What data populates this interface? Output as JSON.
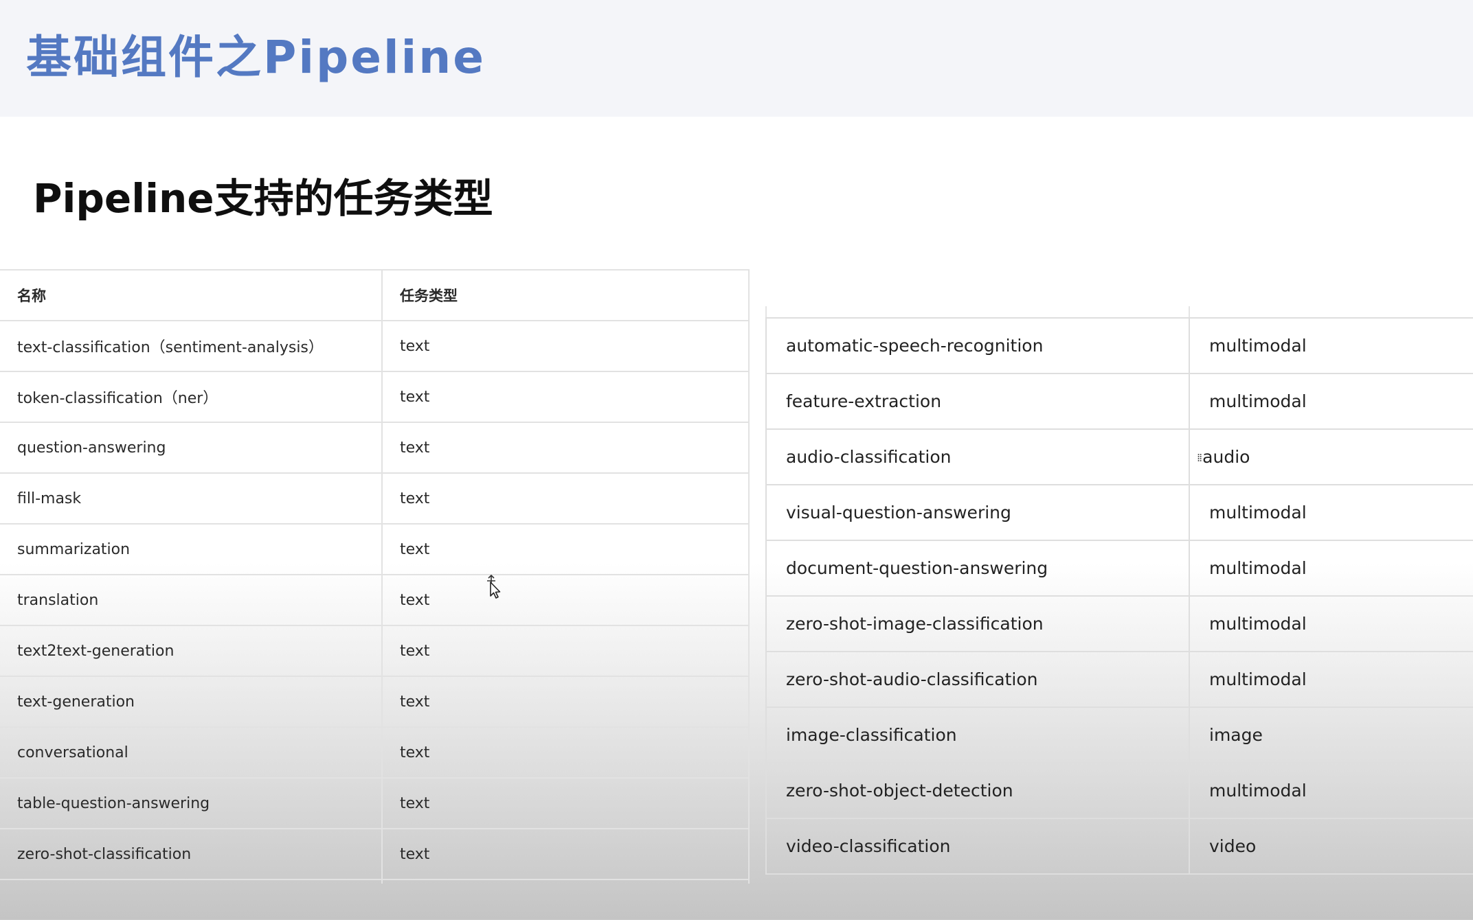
{
  "header": {
    "title": "基础组件之Pipeline"
  },
  "slide": {
    "title": "Pipeline支持的任务类型"
  },
  "left_table": {
    "headers": [
      "名称",
      "任务类型"
    ],
    "rows": [
      [
        "text-classification（sentiment-analysis）",
        "text"
      ],
      [
        "token-classification（ner）",
        "text"
      ],
      [
        "question-answering",
        "text"
      ],
      [
        "fill-mask",
        "text"
      ],
      [
        "summarization",
        "text"
      ],
      [
        "translation",
        "text"
      ],
      [
        "text2text-generation",
        "text"
      ],
      [
        "text-generation",
        "text"
      ],
      [
        "conversational",
        "text"
      ],
      [
        "table-question-answering",
        "text"
      ],
      [
        "zero-shot-classification",
        "text"
      ]
    ]
  },
  "right_table": {
    "rows": [
      [
        "automatic-speech-recognition",
        "multimodal"
      ],
      [
        "feature-extraction",
        "multimodal"
      ],
      [
        "audio-classification",
        "audio"
      ],
      [
        "visual-question-answering",
        "multimodal"
      ],
      [
        "document-question-answering",
        "multimodal"
      ],
      [
        "zero-shot-image-classification",
        "multimodal"
      ],
      [
        "zero-shot-audio-classification",
        "multimodal"
      ],
      [
        "image-classification",
        "image"
      ],
      [
        "zero-shot-object-detection",
        "multimodal"
      ],
      [
        "video-classification",
        "video"
      ]
    ]
  },
  "icons": {
    "drag_handle": "drag-handle-icon",
    "cursor": "move-cursor-icon"
  },
  "colors": {
    "header_title": "#5479c2",
    "header_band": "#f4f5f9"
  }
}
